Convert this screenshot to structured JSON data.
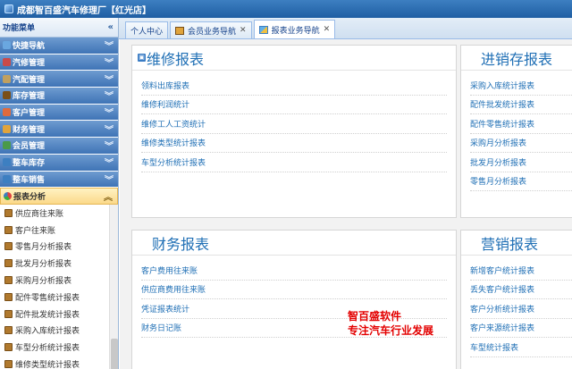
{
  "app": {
    "title": "成都智百盛汽车修理厂【红光店】"
  },
  "sidebar": {
    "header": "功能菜单",
    "menus": [
      {
        "label": "快捷导航",
        "icon": "home-icon",
        "color": "#6aa7e0"
      },
      {
        "label": "汽修管理",
        "icon": "tools-icon",
        "color": "#c94a4a"
      },
      {
        "label": "汽配管理",
        "icon": "parts-icon",
        "color": "#c0a060"
      },
      {
        "label": "库存管理",
        "icon": "inventory-icon",
        "color": "#7a4f17"
      },
      {
        "label": "客户管理",
        "icon": "customer-icon",
        "color": "#e06a3c"
      },
      {
        "label": "财务管理",
        "icon": "finance-icon",
        "color": "#e0a43c"
      },
      {
        "label": "会员管理",
        "icon": "member-icon",
        "color": "#4a9a4a"
      },
      {
        "label": "整车库存",
        "icon": "car-stock-icon",
        "color": "#3d7fc1"
      },
      {
        "label": "整车销售",
        "icon": "car-sales-icon",
        "color": "#3d7fc1"
      }
    ],
    "active_menu": {
      "label": "报表分析",
      "icon": "pie-chart-icon",
      "color": "#e04040"
    },
    "sub_items": [
      "供应商往来账",
      "客户往来账",
      "零售月分析报表",
      "批发月分析报表",
      "采购月分析报表",
      "配件零售统计报表",
      "配件批发统计报表",
      "采购入库统计报表",
      "车型分析统计报表",
      "维修类型统计报表"
    ]
  },
  "tabs": [
    {
      "label": "个人中心"
    },
    {
      "label": "会员业务导航"
    },
    {
      "label": "报表业务导航"
    }
  ],
  "cards": {
    "repair": {
      "title": "维修报表",
      "links": [
        "领料出库报表",
        "维修利润统计",
        "维修工人工资统计",
        "维修类型统计报表",
        "车型分析统计报表"
      ]
    },
    "stock": {
      "title": "进销存报表",
      "links": [
        "采购入库统计报表",
        "配件批发统计报表",
        "配件零售统计报表",
        "采购月分析报表",
        "批发月分析报表",
        "零售月分析报表"
      ]
    },
    "finance": {
      "title": "财务报表",
      "links": [
        "客户费用往来账",
        "供应商费用往来账",
        "凭证报表统计",
        "财务日记账"
      ]
    },
    "marketing": {
      "title": "营销报表",
      "links": [
        "新增客户统计报表",
        "丢失客户统计报表",
        "客户分析统计报表",
        "客户来源统计报表",
        "车型统计报表"
      ]
    }
  },
  "watermark": {
    "line1": "智百盛软件",
    "line2": "专注汽车行业发展"
  }
}
